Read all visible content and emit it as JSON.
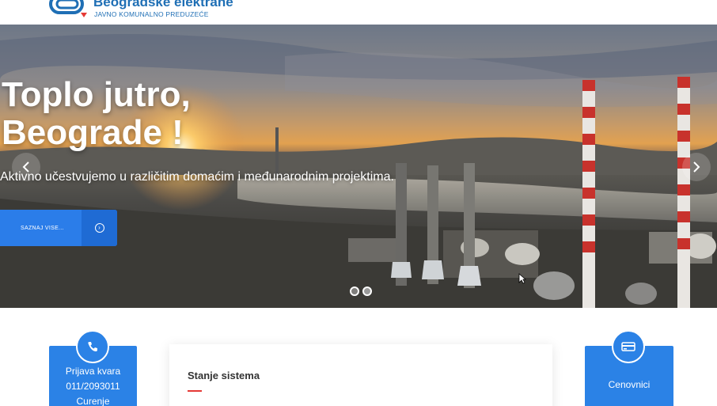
{
  "header": {
    "logo_title": "Beogradske elektrane",
    "logo_subtitle": "JAVNO KOMUNALNO PREDUZEĆE"
  },
  "hero": {
    "title_line1": "Toplo jutro,",
    "title_line2": "Beograde !",
    "subtitle": "Aktivno učestvujemo u različitim domaćim i međunarodnim projektima.",
    "cta_label": "SAZNAJ VISE...",
    "prev_icon": "chevron-left-icon",
    "next_icon": "chevron-right-icon",
    "slides_total": 2,
    "active_slide": 2
  },
  "cards": {
    "report": {
      "icon": "phone-icon",
      "line1": "Prijava kvara",
      "line2": "011/2093011",
      "line3": "Curenje"
    },
    "status": {
      "title": "Stanje sistema"
    },
    "prices": {
      "icon": "credit-card-icon",
      "label": "Cenovnici"
    }
  },
  "colors": {
    "brand_blue": "#2b82e6",
    "logo_blue": "#1f6fb5",
    "accent_red": "#e53935"
  }
}
